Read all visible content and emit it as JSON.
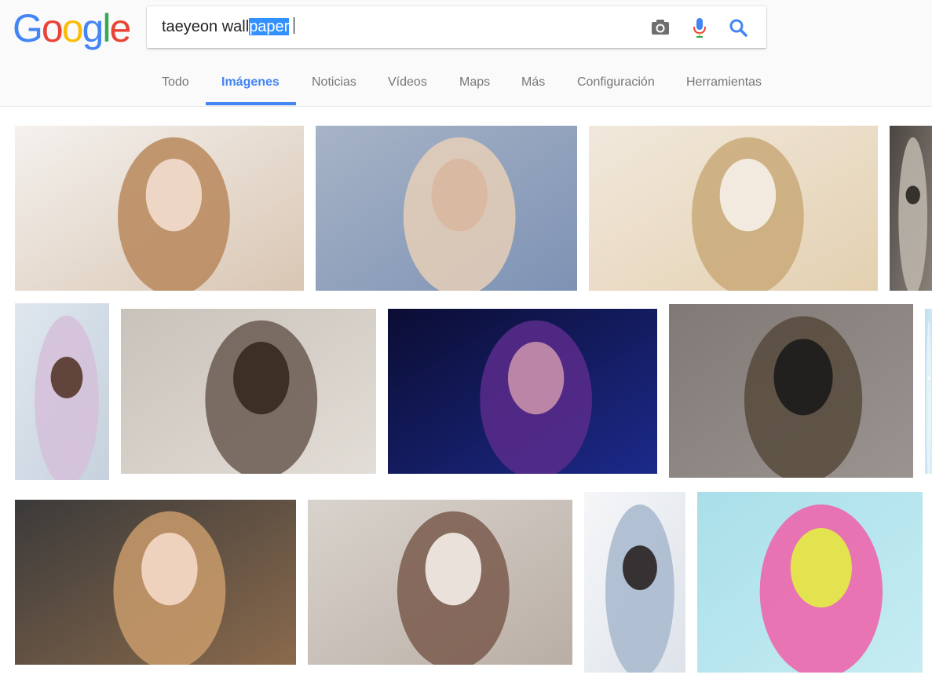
{
  "logo": {
    "letters": [
      "G",
      "o",
      "o",
      "g",
      "l",
      "e"
    ],
    "colors": [
      "#4285f4",
      "#ea4335",
      "#fbbc05",
      "#4285f4",
      "#34a853",
      "#ea4335"
    ]
  },
  "search": {
    "query_plain": "taeyeon wall",
    "query_selected": "paper",
    "icons": [
      "camera-icon",
      "microphone-icon",
      "search-icon"
    ]
  },
  "tabs": [
    {
      "label": "Todo",
      "active": false
    },
    {
      "label": "Imágenes",
      "active": true
    },
    {
      "label": "Noticias",
      "active": false
    },
    {
      "label": "Vídeos",
      "active": false
    },
    {
      "label": "Maps",
      "active": false
    },
    {
      "label": "Más",
      "active": false
    },
    {
      "label": "Configuración",
      "active": false
    },
    {
      "label": "Herramientas",
      "active": false
    }
  ],
  "colors": {
    "accent": "#4285f4",
    "tab_text": "#777777",
    "header_bg": "#fafafa"
  },
  "results": [
    {
      "name": "result-image-1",
      "palette": [
        "#f4f1ee",
        "#d9c6b3",
        "#b8885c",
        "#efd9c9"
      ]
    },
    {
      "name": "result-image-2",
      "palette": [
        "#a7b3c6",
        "#7d92b4",
        "#e6cfb7",
        "#d9b8a0"
      ]
    },
    {
      "name": "result-image-3",
      "palette": [
        "#f1e8dc",
        "#e3d0b0",
        "#c9a978",
        "#f4ede4"
      ]
    },
    {
      "name": "result-image-4",
      "palette": [
        "#4b4642",
        "#8a8078",
        "#c0b8ae",
        "#2e2b28"
      ]
    },
    {
      "name": "result-image-5",
      "palette": [
        "#dfe6ee",
        "#c6d1dd",
        "#d5bfd9",
        "#5b3d32"
      ]
    },
    {
      "name": "result-image-6",
      "palette": [
        "#c9c2bb",
        "#e2ddd6",
        "#6a5b50",
        "#3a2b23"
      ]
    },
    {
      "name": "result-image-7",
      "palette": [
        "#0b0d33",
        "#1c2a8a",
        "#5a2c8c",
        "#c08aa8"
      ]
    },
    {
      "name": "result-image-8",
      "palette": [
        "#807975",
        "#9a938f",
        "#564a3b",
        "#1f1d1c"
      ]
    },
    {
      "name": "result-image-9",
      "palette": [
        "#bfe0ee",
        "#d8eef6",
        "#e9f5fa",
        "#ffffff"
      ]
    },
    {
      "name": "result-image-10",
      "palette": [
        "#3b3a3a",
        "#8a6a4c",
        "#c99b6b",
        "#f0d6c2"
      ]
    },
    {
      "name": "result-image-11",
      "palette": [
        "#d9d3cd",
        "#b9aea5",
        "#7a5a4c",
        "#efe8e2"
      ]
    },
    {
      "name": "result-image-12",
      "palette": [
        "#f5f6f8",
        "#dde3ea",
        "#a7b7cc",
        "#2f2a2a"
      ]
    },
    {
      "name": "result-image-13",
      "palette": [
        "#a9dfe9",
        "#c6ecf2",
        "#f05fa8",
        "#e3e94a"
      ]
    }
  ]
}
